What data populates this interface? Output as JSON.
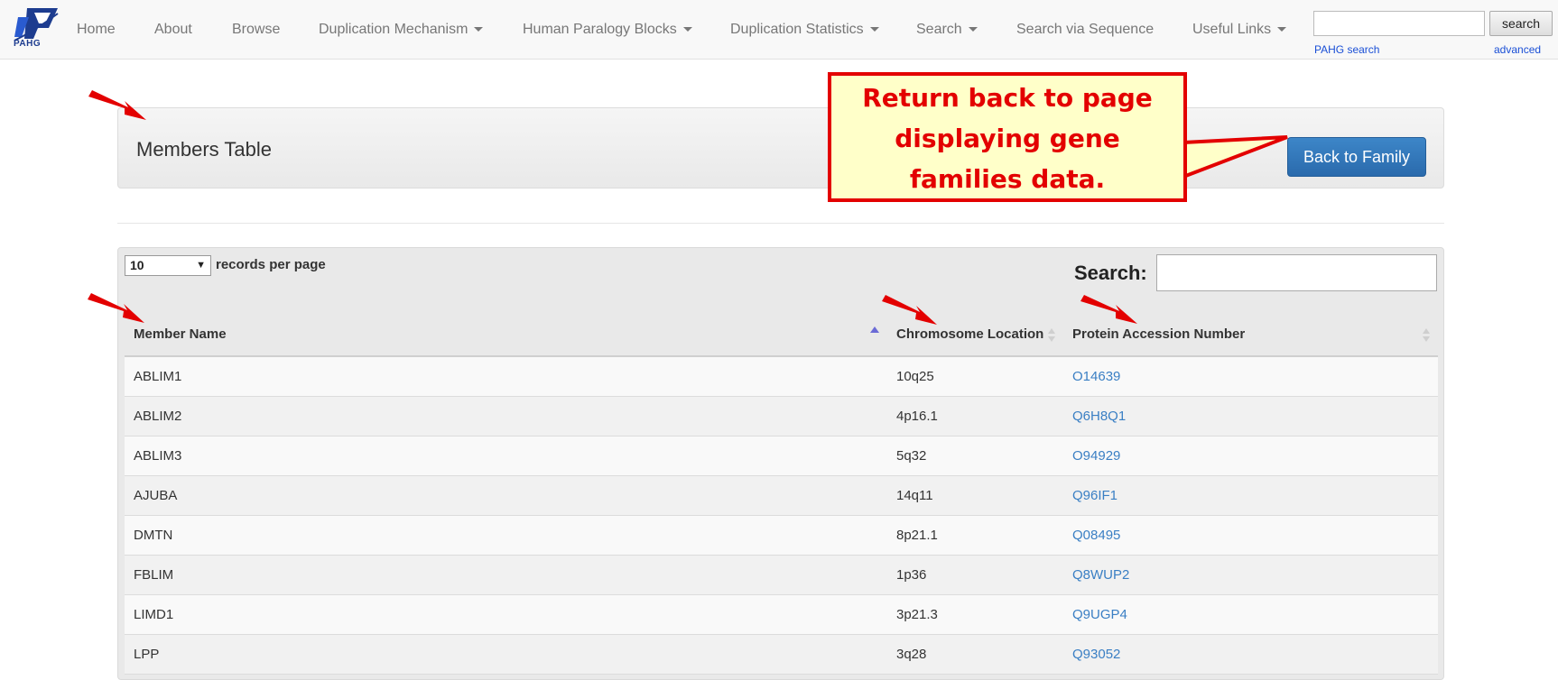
{
  "brand": {
    "logo_text": "PAHG"
  },
  "nav": {
    "items": [
      {
        "label": "Home",
        "dropdown": false
      },
      {
        "label": "About",
        "dropdown": false
      },
      {
        "label": "Browse",
        "dropdown": false
      },
      {
        "label": "Duplication Mechanism",
        "dropdown": true
      },
      {
        "label": "Human Paralogy Blocks",
        "dropdown": true
      },
      {
        "label": "Duplication Statistics",
        "dropdown": true
      },
      {
        "label": "Search",
        "dropdown": true
      },
      {
        "label": "Search via Sequence",
        "dropdown": false
      },
      {
        "label": "Useful Links",
        "dropdown": true
      }
    ],
    "search_button": "search",
    "search_link": "PAHG search",
    "advanced_link": "advanced"
  },
  "panel": {
    "title": "Members Table",
    "back_button": "Back to Family"
  },
  "callout": {
    "lines": [
      "Return back to page",
      "displaying gene",
      "families data."
    ]
  },
  "table": {
    "page_length": "10",
    "page_length_label": "records per page",
    "search_label": "Search:",
    "columns": [
      "Member Name",
      "Chromosome Location",
      "Protein Accession Number"
    ],
    "rows": [
      {
        "name": "ABLIM1",
        "location": "10q25",
        "accession": "O14639"
      },
      {
        "name": "ABLIM2",
        "location": "4p16.1",
        "accession": "Q6H8Q1"
      },
      {
        "name": "ABLIM3",
        "location": "5q32",
        "accession": "O94929"
      },
      {
        "name": "AJUBA",
        "location": "14q11",
        "accession": "Q96IF1"
      },
      {
        "name": "DMTN",
        "location": "8p21.1",
        "accession": "Q08495"
      },
      {
        "name": "FBLIM",
        "location": "1p36",
        "accession": "Q8WUP2"
      },
      {
        "name": "LIMD1",
        "location": "3p21.3",
        "accession": "Q9UGP4"
      },
      {
        "name": "LPP",
        "location": "3q28",
        "accession": "Q93052"
      }
    ]
  },
  "colors": {
    "annotation_red": "#e30000",
    "callout_fill": "#ffffc9",
    "button_blue": "#2f74b8",
    "link_blue": "#3a7fc4",
    "sort_active": "#6b6bd6"
  }
}
